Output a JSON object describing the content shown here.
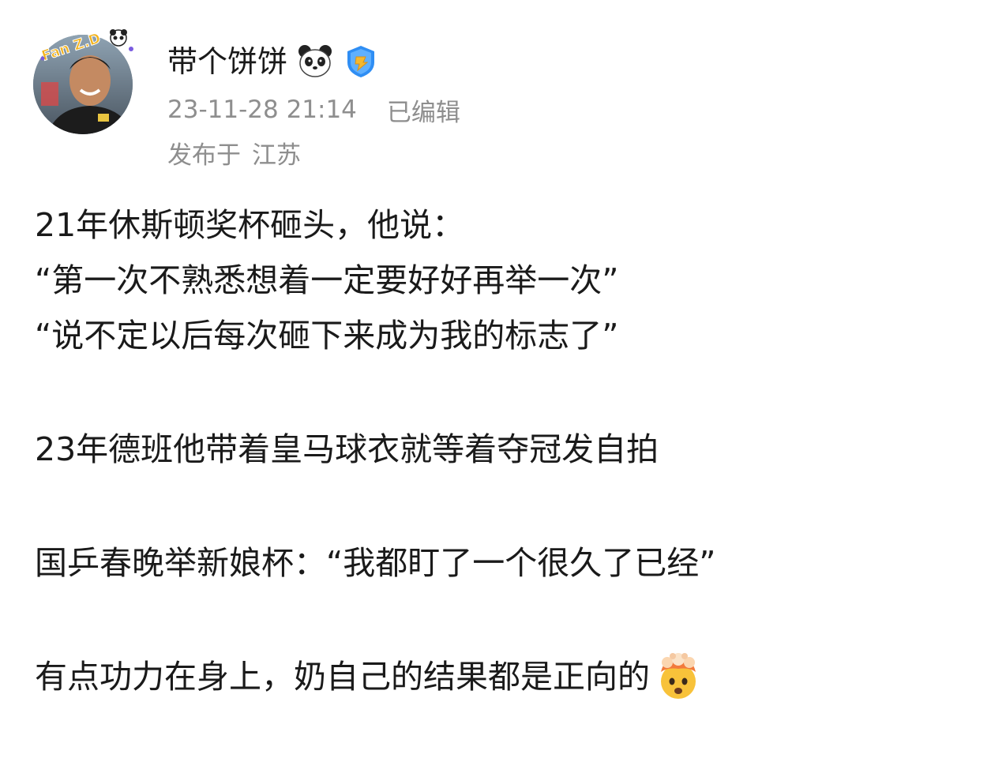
{
  "user": {
    "name": "带个饼饼",
    "name_emoji_icon": "panda-face-icon",
    "verified_badge_icon": "gold-verified-badge-icon",
    "avatar_icon": "user-avatar-photo",
    "avatar_sticker_text": "Fan Z.D"
  },
  "meta": {
    "timestamp": "23-11-28 21:14",
    "edited_label": "已编辑",
    "location_prefix": "发布于",
    "location": "江苏"
  },
  "post": {
    "line1": "21年休斯顿奖杯砸头，他说：",
    "line2": "“第一次不熟悉想着一定要好好再举一次”",
    "line3": "“说不定以后每次砸下来成为我的标志了”",
    "line4": "23年德班他带着皇马球衣就等着夺冠发自拍",
    "line5": "国乒春晚举新娘杯：“我都盯了一个很久了已经”",
    "line6": "有点功力在身上，奶自己的结果都是正向的",
    "line6_emoji_icon": "exploding-head-emoji-icon"
  },
  "colors": {
    "text": "#1a1a1a",
    "meta": "#8e8e8e",
    "badge_blue": "#2f8ef4",
    "badge_gold": "#f5b82e"
  }
}
